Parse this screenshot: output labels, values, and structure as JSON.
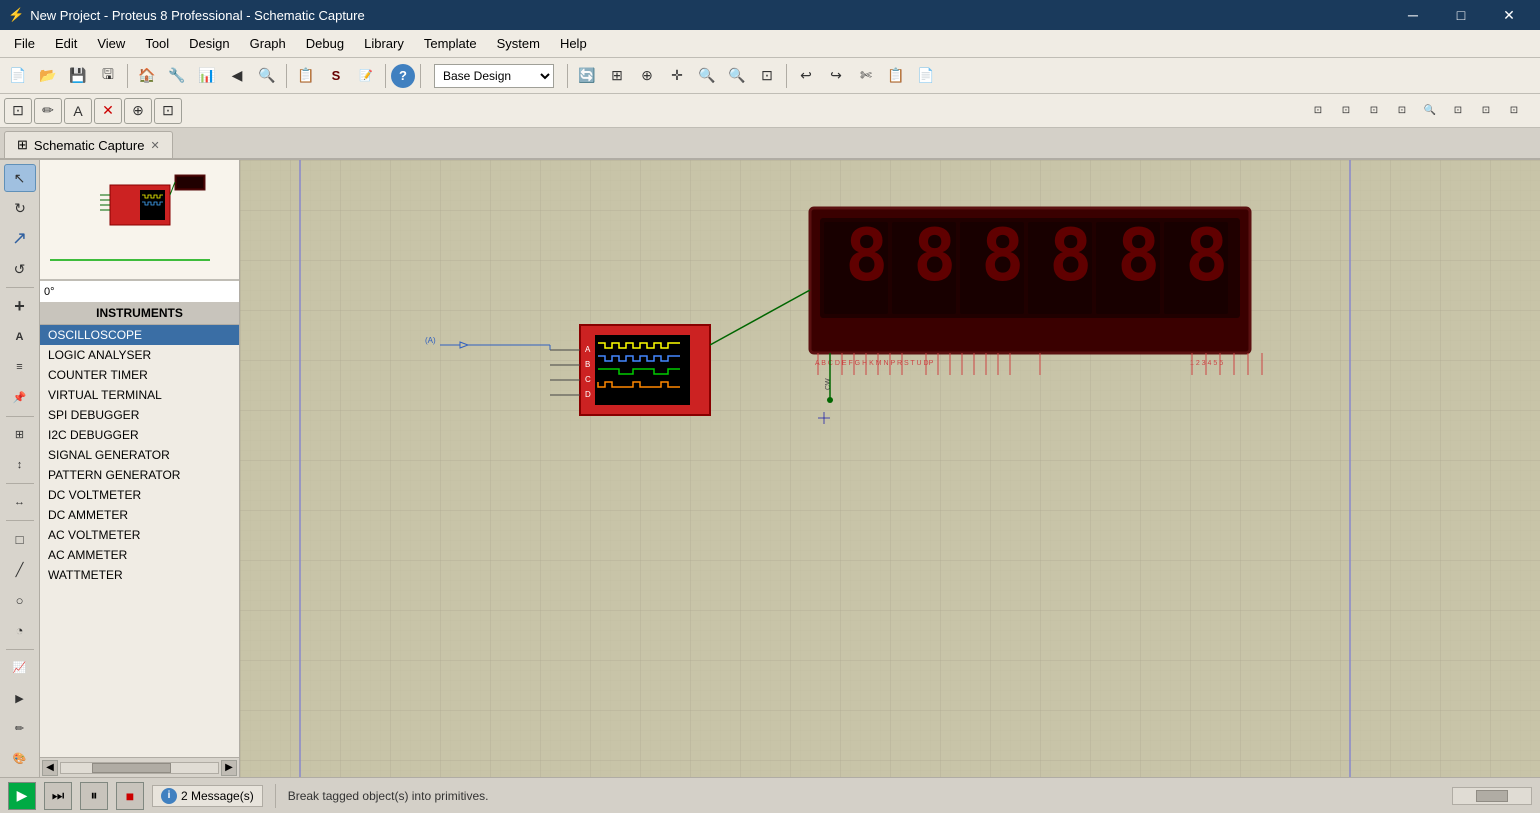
{
  "titleBar": {
    "title": "New Project - Proteus 8 Professional - Schematic Capture",
    "icon": "⚡",
    "minimize": "─",
    "restore": "□",
    "close": "✕"
  },
  "menuBar": {
    "items": [
      "File",
      "Edit",
      "View",
      "Tool",
      "Design",
      "Graph",
      "Debug",
      "Library",
      "Template",
      "System",
      "Help"
    ]
  },
  "toolbar1": {
    "buttons": [
      "📄",
      "📂",
      "💾",
      "🖨",
      "🏠",
      "🔧",
      "⚙",
      "◀",
      "🔍",
      "📋",
      "S",
      "📝",
      "❓"
    ]
  },
  "toolbar2": {
    "buttons": [
      "↩",
      "↪",
      "✄",
      "📋",
      "📄",
      "⊡",
      "⊡",
      "⊡",
      "⊡",
      "⊡"
    ],
    "designSelector": "Base Design"
  },
  "leftToolbar": {
    "buttons": [
      {
        "name": "select",
        "icon": "↖",
        "active": true
      },
      {
        "name": "redo",
        "icon": "↺"
      },
      {
        "name": "wire",
        "icon": "↗"
      },
      {
        "name": "undo-tool",
        "icon": "↻"
      },
      {
        "name": "component",
        "icon": "+"
      },
      {
        "name": "label",
        "icon": "A"
      },
      {
        "name": "bus",
        "icon": "≡"
      },
      {
        "name": "pin",
        "icon": "📌"
      },
      {
        "name": "junction",
        "icon": "●"
      },
      {
        "name": "power",
        "icon": "⚡"
      },
      {
        "name": "ground",
        "icon": "⏚"
      },
      {
        "name": "port",
        "icon": "▷"
      },
      {
        "name": "probe",
        "icon": "P"
      },
      {
        "name": "virtual-inst",
        "icon": "↔"
      },
      {
        "name": "draw-rect",
        "icon": "□"
      },
      {
        "name": "draw-line",
        "icon": "╱"
      },
      {
        "name": "draw-ellipse",
        "icon": "○"
      },
      {
        "name": "draw-arc",
        "icon": "◔"
      },
      {
        "name": "graph",
        "icon": "📈"
      },
      {
        "name": "tape",
        "icon": "▶"
      },
      {
        "name": "pen",
        "icon": "✏"
      },
      {
        "name": "paint",
        "icon": "🎨"
      }
    ]
  },
  "panel": {
    "angle": "0°",
    "instrumentsHeader": "INSTRUMENTS",
    "instruments": [
      {
        "id": "oscilloscope",
        "label": "OSCILLOSCOPE",
        "selected": true
      },
      {
        "id": "logic-analyser",
        "label": "LOGIC ANALYSER"
      },
      {
        "id": "counter-timer",
        "label": "COUNTER TIMER"
      },
      {
        "id": "virtual-terminal",
        "label": "VIRTUAL TERMINAL"
      },
      {
        "id": "spi-debugger",
        "label": "SPI DEBUGGER"
      },
      {
        "id": "i2c-debugger",
        "label": "I2C DEBUGGER"
      },
      {
        "id": "signal-generator",
        "label": "SIGNAL GENERATOR"
      },
      {
        "id": "pattern-gen",
        "label": "PATTERN GENERATOR"
      },
      {
        "id": "dc-voltmeter",
        "label": "DC VOLTMETER"
      },
      {
        "id": "dc-ammeter",
        "label": "DC AMMETER"
      },
      {
        "id": "ac-voltmeter",
        "label": "AC VOLTMETER"
      },
      {
        "id": "ac-ammeter",
        "label": "AC AMMETER"
      },
      {
        "id": "wattmeter",
        "label": "WATTMETER"
      }
    ]
  },
  "tab": {
    "icon": "⊞",
    "label": "Schematic Capture",
    "close": "✕"
  },
  "statusBar": {
    "messages": "2 Message(s)",
    "text": "Break tagged object(s) into primitives.",
    "infoIcon": "i"
  },
  "canvas": {
    "ssd": {
      "pins_left": [
        "A",
        "B",
        "C",
        "D",
        "E",
        "F",
        "G",
        "H",
        "K",
        "M",
        "N",
        "P",
        "R",
        "S",
        "T",
        "U",
        "DP"
      ],
      "pins_right": [
        "1",
        "2",
        "3",
        "4",
        "5",
        "6"
      ],
      "digits": [
        "8",
        "8",
        "8",
        "8",
        "8",
        "8"
      ],
      "control_pin": "CW"
    },
    "logicComp": {
      "inputs": [
        "A",
        "B",
        "C",
        "D"
      ],
      "position": "top:165px;left:340px"
    }
  }
}
